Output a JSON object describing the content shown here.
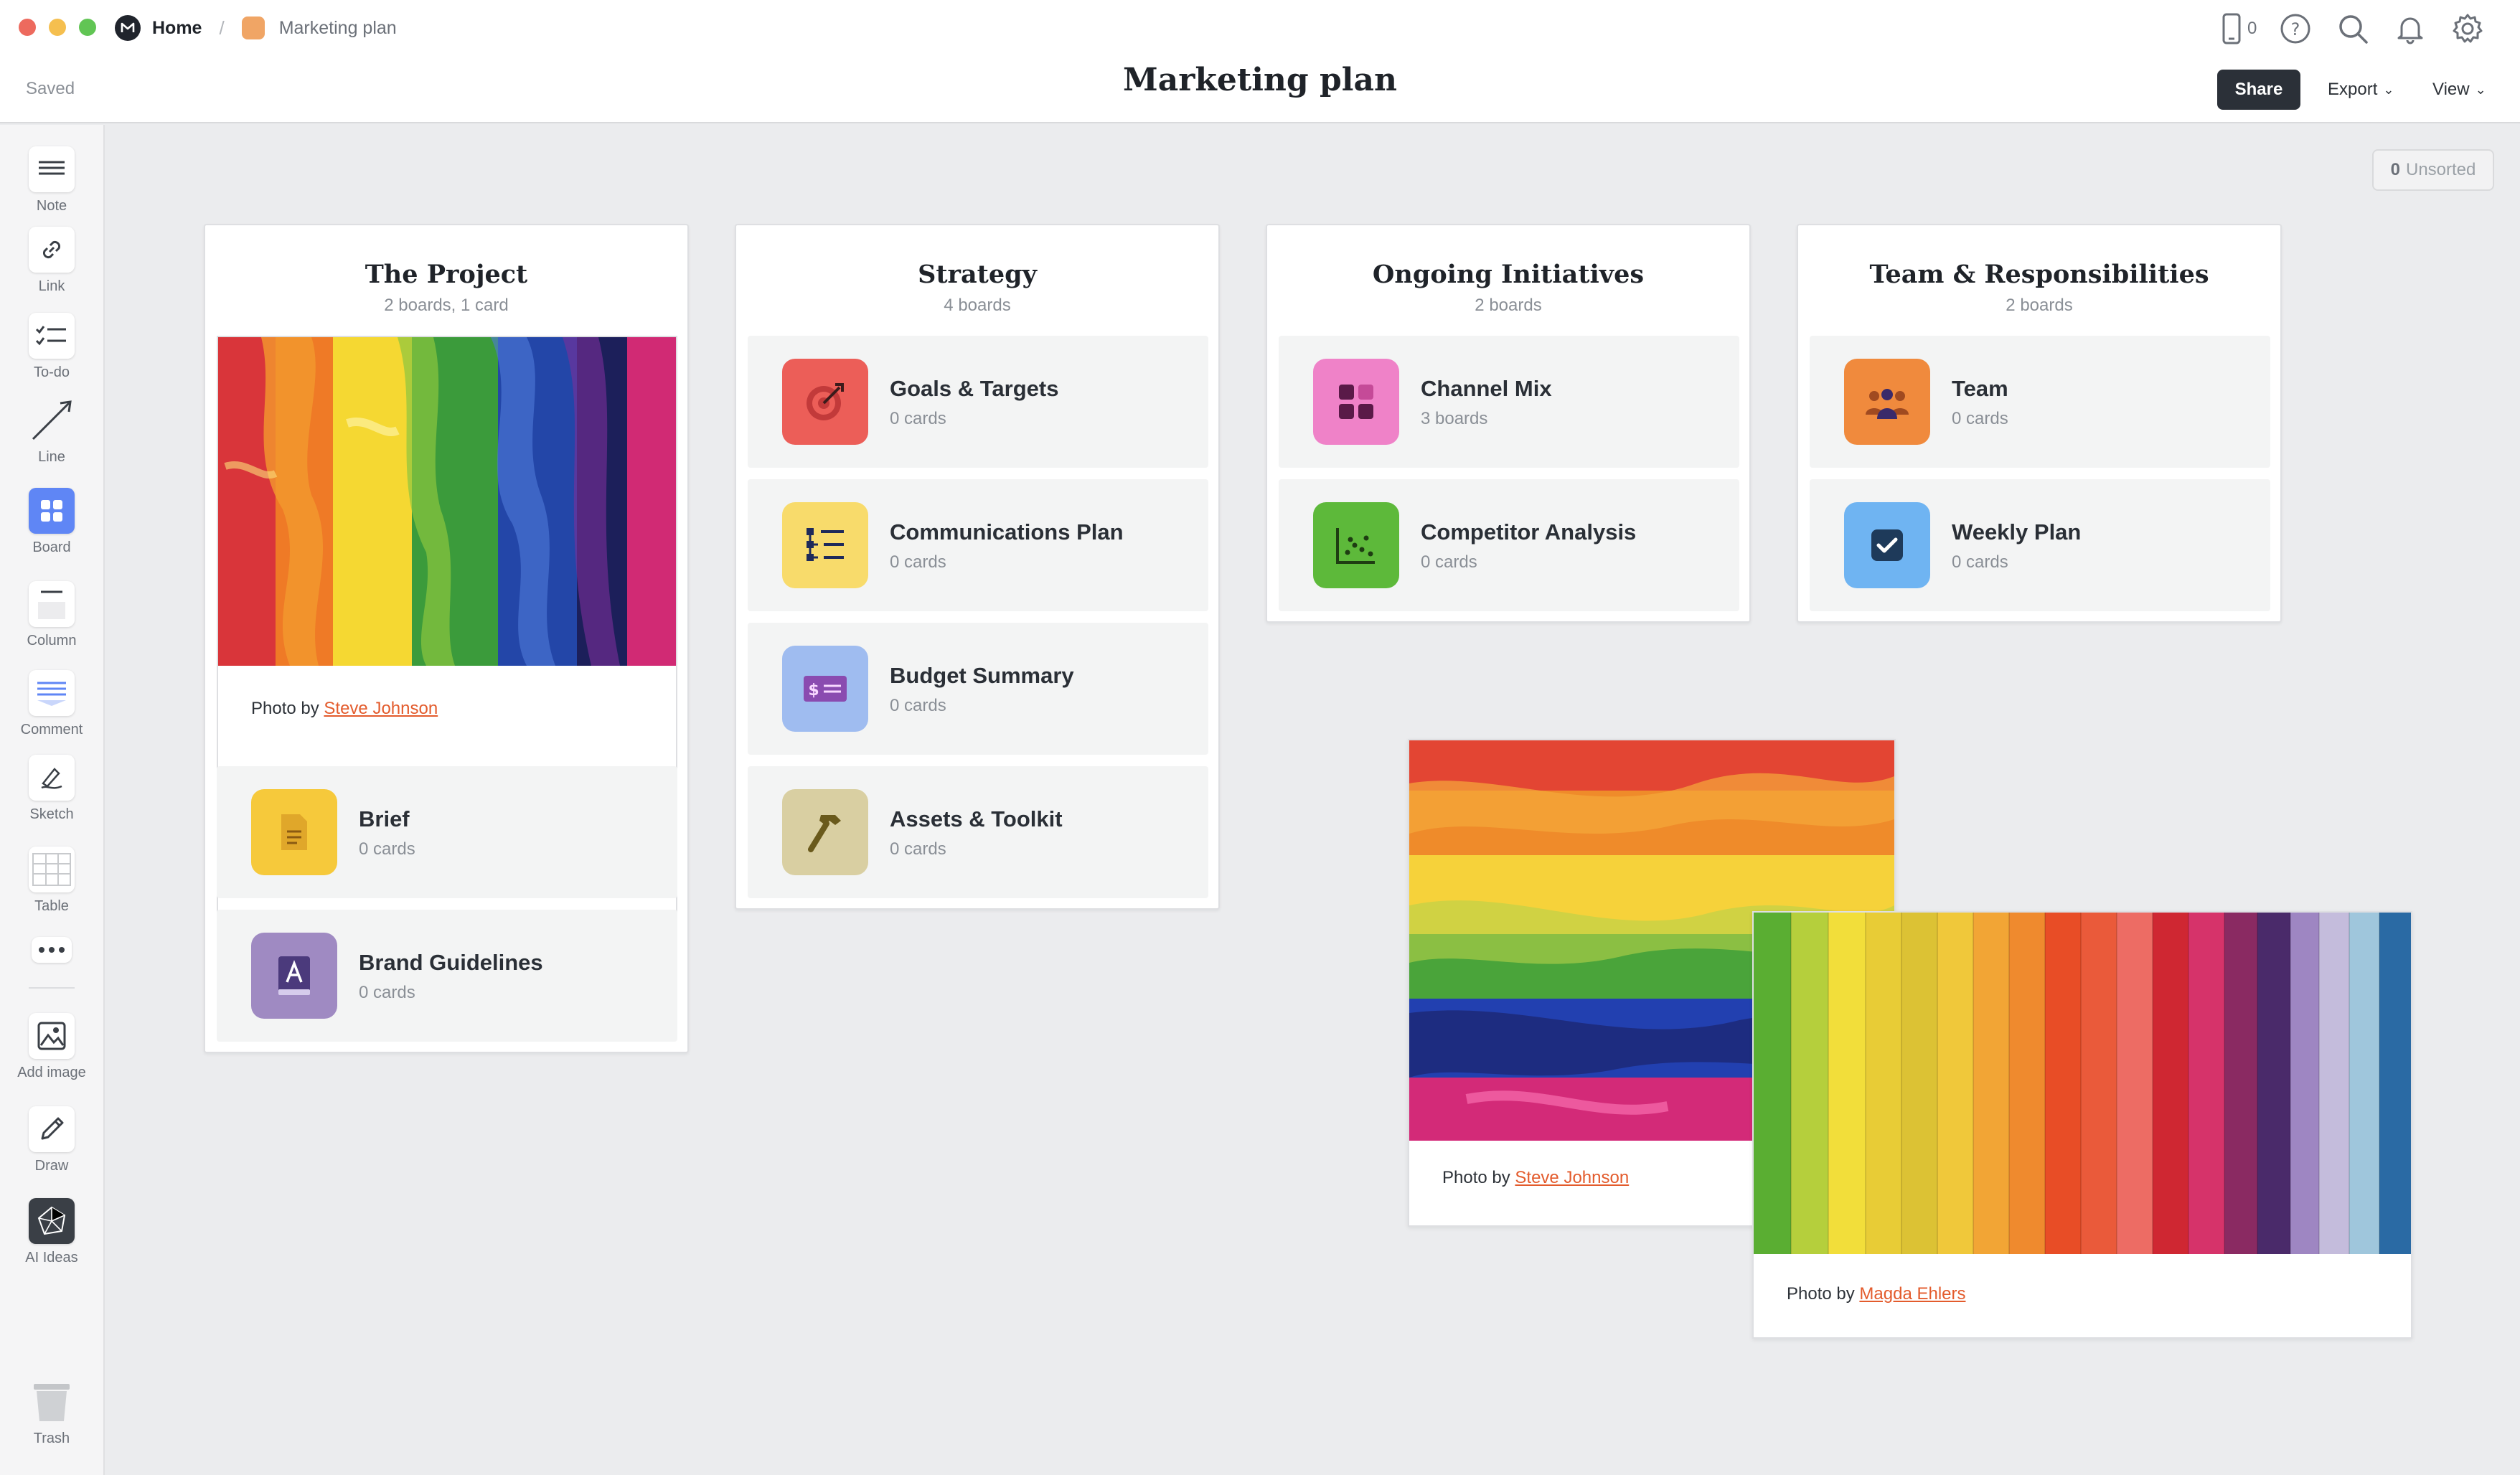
{
  "header": {
    "home_label": "Home",
    "breadcrumb_label": "Marketing plan",
    "saved_status": "Saved",
    "title": "Marketing plan",
    "share_label": "Share",
    "export_label": "Export",
    "view_label": "View",
    "device_count": "0",
    "accent_color": "#f0a565"
  },
  "toolbar": {
    "items": [
      {
        "label": "Note",
        "icon": "note-icon"
      },
      {
        "label": "Link",
        "icon": "link-icon"
      },
      {
        "label": "To-do",
        "icon": "todo-icon"
      },
      {
        "label": "Line",
        "icon": "line-icon"
      },
      {
        "label": "Board",
        "icon": "board-icon"
      },
      {
        "label": "Column",
        "icon": "column-icon"
      },
      {
        "label": "Comment",
        "icon": "comment-icon"
      },
      {
        "label": "Sketch",
        "icon": "sketch-icon"
      },
      {
        "label": "Table",
        "icon": "table-icon"
      },
      {
        "label": "Add image",
        "icon": "add-image-icon"
      },
      {
        "label": "Draw",
        "icon": "draw-icon"
      },
      {
        "label": "AI Ideas",
        "icon": "ai-ideas-icon"
      },
      {
        "label": "Trash",
        "icon": "trash-icon"
      }
    ]
  },
  "unsorted": {
    "count": "0",
    "label": "Unsorted"
  },
  "columns": [
    {
      "title": "The Project",
      "subtitle": "2 boards, 1 card",
      "image_caption_prefix": "Photo by",
      "image_caption_author": "Steve Johnson",
      "boards": [
        {
          "title": "Brief",
          "subtitle": "0 cards",
          "color": "#f6c93b",
          "icon": "document-icon"
        },
        {
          "title": "Brand Guidelines",
          "subtitle": "0 cards",
          "color": "#9f8ac2",
          "icon": "guidelines-book-icon"
        }
      ]
    },
    {
      "title": "Strategy",
      "subtitle": "4 boards",
      "boards": [
        {
          "title": "Goals & Targets",
          "subtitle": "0 cards",
          "color": "#ec5e58",
          "icon": "target-icon"
        },
        {
          "title": "Communications Plan",
          "subtitle": "0 cards",
          "color": "#f8db6b",
          "icon": "hierarchy-list-icon"
        },
        {
          "title": "Budget Summary",
          "subtitle": "0 cards",
          "color": "#9fbcf0",
          "icon": "money-icon"
        },
        {
          "title": "Assets & Toolkit",
          "subtitle": "0 cards",
          "color": "#d9cfa2",
          "icon": "hammer-icon"
        }
      ]
    },
    {
      "title": "Ongoing Initiatives",
      "subtitle": "2 boards",
      "boards": [
        {
          "title": "Channel Mix",
          "subtitle": "3 boards",
          "color": "#ef82c8",
          "icon": "grid-icon"
        },
        {
          "title": "Competitor Analysis",
          "subtitle": "0 cards",
          "color": "#5db93a",
          "icon": "scatter-chart-icon"
        }
      ]
    },
    {
      "title": "Team & Responsibilities",
      "subtitle": "2 boards",
      "boards": [
        {
          "title": "Team",
          "subtitle": "0 cards",
          "color": "#f08a3d",
          "icon": "people-icon"
        },
        {
          "title": "Weekly Plan",
          "subtitle": "0 cards",
          "color": "#6fb4f2",
          "icon": "checkbox-icon"
        }
      ]
    }
  ],
  "free_images": [
    {
      "caption_prefix": "Photo by",
      "caption_author": "Steve Johnson"
    },
    {
      "caption_prefix": "Photo by",
      "caption_author": "Magda Ehlers"
    }
  ]
}
